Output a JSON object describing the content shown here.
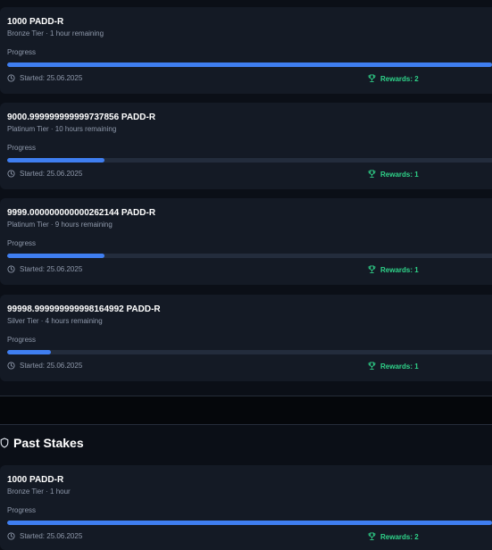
{
  "active_stakes": [
    {
      "amount": "1000 PADD-R",
      "subtitle": "Bronze Tier · 1 hour remaining",
      "progress_label": "Progress",
      "progress": 1.0,
      "started": "Started: 25.06.2025",
      "rewards": "Rewards: 2"
    },
    {
      "amount": "9000.999999999999737856 PADD-R",
      "subtitle": "Platinum Tier · 10 hours remaining",
      "progress_label": "Progress",
      "progress": 0.2,
      "started": "Started: 25.06.2025",
      "rewards": "Rewards: 1"
    },
    {
      "amount": "9999.000000000000262144 PADD-R",
      "subtitle": "Platinum Tier · 9 hours remaining",
      "progress_label": "Progress",
      "progress": 0.2,
      "started": "Started: 25.06.2025",
      "rewards": "Rewards: 1"
    },
    {
      "amount": "99998.999999999998164992 PADD-R",
      "subtitle": "Silver Tier · 4 hours remaining",
      "progress_label": "Progress",
      "progress": 0.09,
      "started": "Started: 25.06.2025",
      "rewards": "Rewards: 1"
    }
  ],
  "past_stakes": {
    "title": "Past Stakes",
    "icon": "shield-icon",
    "items": [
      {
        "amount": "1000 PADD-R",
        "subtitle": "Bronze Tier · 1 hour",
        "progress_label": "Progress",
        "progress": 1.0,
        "started": "Started: 25.06.2025",
        "rewards": "Rewards: 2"
      }
    ]
  },
  "colors": {
    "accent": "#3f7ef0",
    "rewards": "#2fd48a",
    "card": "#141a25",
    "background": "#0b0f17"
  }
}
